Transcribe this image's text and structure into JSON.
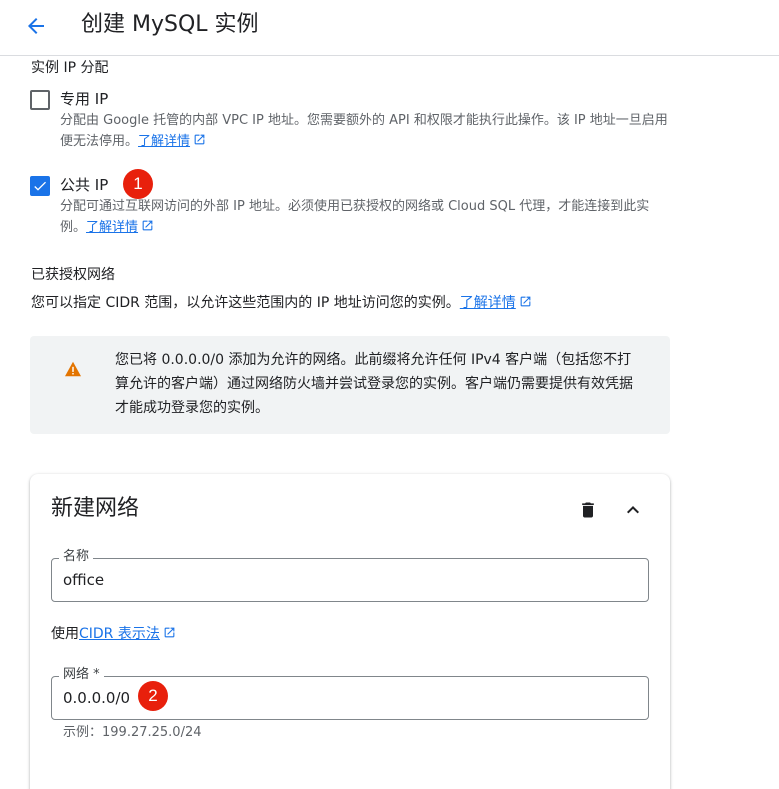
{
  "header": {
    "title": "创建 MySQL 实例",
    "back_icon": "arrow-back-icon"
  },
  "ip_assignment": {
    "label": "实例 IP 分配",
    "private_ip": {
      "label": "专用 IP",
      "checked": false,
      "description": "分配由 Google 托管的内部 VPC IP 地址。您需要额外的 API 和权限才能执行此操作。该 IP 地址一旦启用便无法停用。",
      "link": "了解详情"
    },
    "public_ip": {
      "label": "公共 IP",
      "checked": true,
      "description": "分配可通过互联网访问的外部 IP 地址。必须使用已获授权的网络或 Cloud SQL 代理，才能连接到此实例。",
      "link": "了解详情"
    }
  },
  "authorized_networks": {
    "title": "已获授权网络",
    "description": "您可以指定 CIDR 范围，以允许这些范围内的 IP 地址访问您的实例。",
    "link": "了解详情"
  },
  "warning": {
    "text": "您已将 0.0.0.0/0 添加为允许的网络。此前缀将允许任何 IPv4 客户端（包括您不打算允许的客户端）通过网络防火墙并尝试登录您的实例。客户端仍需要提供有效凭据才能成功登录您的实例。",
    "icon": "warning-icon",
    "color": "#e37400"
  },
  "new_network": {
    "title": "新建网络",
    "name_field": {
      "label": "名称",
      "value": "office"
    },
    "cidr_prefix": "使用",
    "cidr_link": "CIDR 表示法",
    "network_field": {
      "label": "网络 *",
      "value": "0.0.0.0/0"
    },
    "hint": "示例：199.27.25.0/24"
  },
  "annotations": {
    "badge_1": "1",
    "badge_2": "2"
  },
  "colors": {
    "accent": "#1a73e8",
    "badge": "#e8200c"
  }
}
